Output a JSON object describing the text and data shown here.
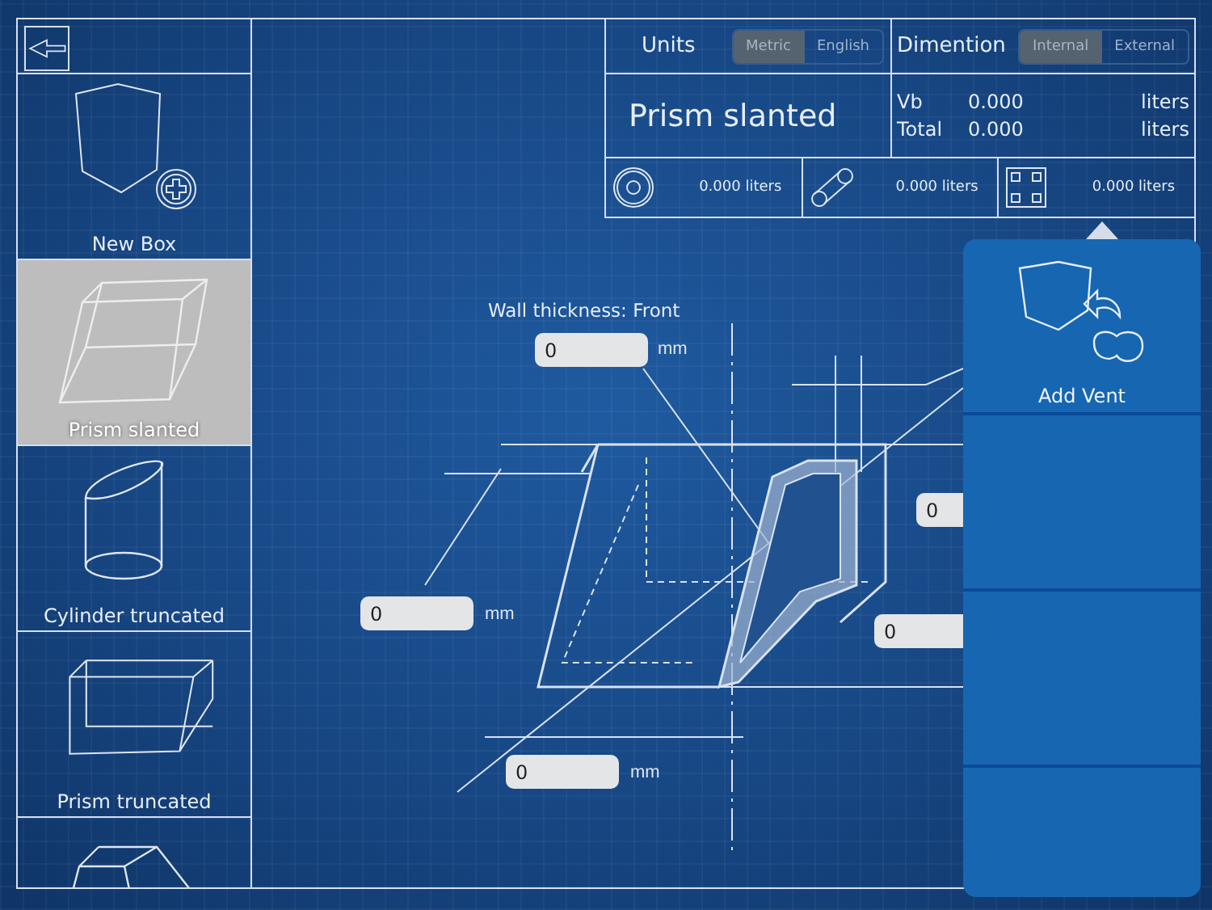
{
  "sidebar": {
    "items": [
      {
        "kind": "new-box",
        "label": "New Box",
        "selected": false
      },
      {
        "kind": "prism-slanted",
        "label": "Prism slanted",
        "selected": true
      },
      {
        "kind": "cylinder-truncated",
        "label": "Cylinder truncated",
        "selected": false
      },
      {
        "kind": "prism-truncated",
        "label": "Prism truncated",
        "selected": false
      },
      {
        "kind": "frustum",
        "selected": false
      }
    ]
  },
  "units": {
    "label": "Units",
    "options": [
      {
        "label": "Metric",
        "selected": true
      },
      {
        "label": "English",
        "selected": false
      }
    ]
  },
  "dimension": {
    "label": "Dimention",
    "options": [
      {
        "label": "Internal",
        "selected": true
      },
      {
        "label": "External",
        "selected": false
      }
    ]
  },
  "shape_title": "Prism slanted",
  "volumes": [
    {
      "label": "Vb",
      "value": "0.000",
      "unit": "liters"
    },
    {
      "label": "Total",
      "value": "0.000",
      "unit": "liters"
    }
  ],
  "components": [
    {
      "kind": "port",
      "reading": "0.000 liters"
    },
    {
      "kind": "tube",
      "reading": "0.000 liters"
    },
    {
      "kind": "grid",
      "reading": "0.000 liters"
    }
  ],
  "canvas": {
    "wall_label": "Wall thickness: Front",
    "fields": [
      {
        "value": "0",
        "unit": "mm"
      },
      {
        "value": "0",
        "unit": "mm"
      },
      {
        "value": "0",
        "unit": "mm"
      },
      {
        "value": "0"
      },
      {
        "value": "0"
      }
    ]
  },
  "popover": {
    "items": [
      {
        "kind": "vent",
        "label": "Add Vent"
      },
      {
        "kind": "blank"
      },
      {
        "kind": "blank"
      },
      {
        "kind": "blank"
      }
    ]
  }
}
